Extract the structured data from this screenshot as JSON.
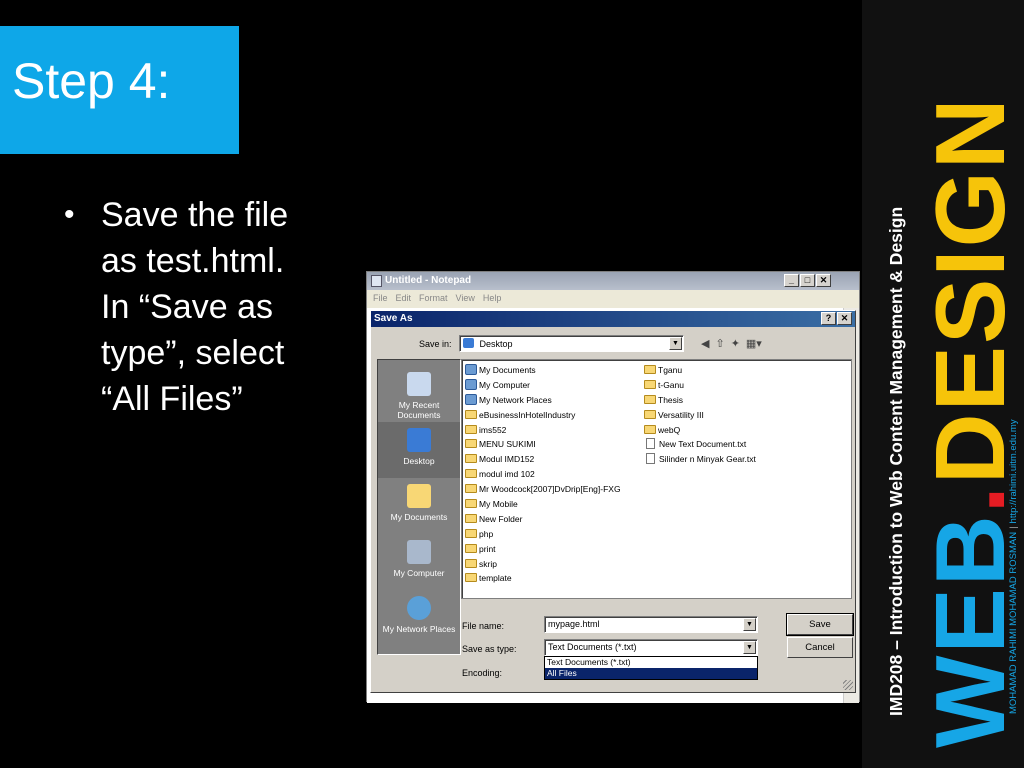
{
  "slide": {
    "title": "Step 4:",
    "bullet_lines": [
      "Save the file",
      "as test.html.",
      "In “Save as",
      "type”, select",
      "“All Files”"
    ]
  },
  "banner": {
    "course": "IMD208 – Introduction to Web Content Management & Design",
    "logo_web": "WEB",
    "logo_dot": ".",
    "logo_design": "DESIGN",
    "author": "MOHAMAD RAHIMI MOHAMAD ROSMAN",
    "separator": "|",
    "url": "http://rahimi.uitm.edu.my"
  },
  "notepad": {
    "title": "Untitled - Notepad",
    "menu": [
      "File",
      "Edit",
      "Format",
      "View",
      "Help"
    ],
    "buttons": [
      "_",
      "□",
      "✕"
    ]
  },
  "dialog": {
    "title": "Save As",
    "title_buttons": [
      "?",
      "✕"
    ],
    "save_in_label": "Save in:",
    "save_in_value": "Desktop",
    "places": [
      "My Recent Documents",
      "Desktop",
      "My Documents",
      "My Computer",
      "My Network Places"
    ],
    "files_col1": [
      "My Documents",
      "My Computer",
      "My Network Places",
      "eBusinessInHotelIndustry",
      "ims552",
      "MENU SUKIMI",
      "Modul IMD152",
      "modul imd 102",
      "Mr Woodcock[2007]DvDrip[Eng]-FXG",
      "My Mobile",
      "New Folder",
      "php",
      "print",
      "skrip",
      "template"
    ],
    "files_col2": [
      "Tganu",
      "t-Ganu",
      "Thesis",
      "Versatility III",
      "webQ",
      "New Text Document.txt",
      "Silinder n Minyak Gear.txt"
    ],
    "file_name_label": "File name:",
    "file_name_value": "mypage.html",
    "save_type_label": "Save as type:",
    "save_type_value": "Text Documents (*.txt)",
    "save_type_options": [
      "Text Documents (*.txt)",
      "All Files"
    ],
    "encoding_label": "Encoding:",
    "save_button": "Save",
    "cancel_button": "Cancel"
  },
  "colors": {
    "title_box": "#0ea7e8",
    "logo_blue": "#16a6e6",
    "logo_red": "#e51c23",
    "logo_yellow": "#f6c40a"
  }
}
